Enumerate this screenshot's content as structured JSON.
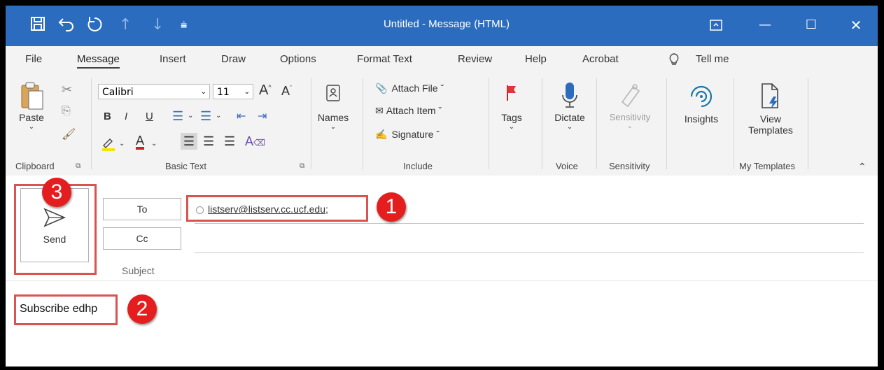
{
  "window": {
    "title": "Untitled  -  Message (HTML)"
  },
  "quick_access": [
    "save-icon",
    "undo-icon",
    "redo-icon",
    "up-arrow-icon",
    "down-arrow-icon",
    "customize-icon"
  ],
  "menu_tabs": [
    "File",
    "Message",
    "Insert",
    "Draw",
    "Options",
    "Format Text",
    "Review",
    "Help",
    "Acrobat"
  ],
  "active_tab": "Message",
  "tell_me": "Tell me",
  "ribbon": {
    "paste": "Paste",
    "font_name": "Calibri",
    "font_size": "11",
    "names": "Names",
    "attach_file": "Attach File ˇ",
    "attach_item": "Attach Item ˇ",
    "signature": "Signature ˇ",
    "tags": "Tags",
    "dictate": "Dictate",
    "sensitivity": "Sensitivity",
    "insights": "Insights",
    "view_templates_1": "View",
    "view_templates_2": "Templates",
    "groups": {
      "clipboard": "Clipboard",
      "basic_text": "Basic Text",
      "include": "Include",
      "voice": "Voice",
      "sensitivity": "Sensitivity",
      "my_templates": "My Templates"
    }
  },
  "compose": {
    "send": "Send",
    "to_label": "To",
    "cc_label": "Cc",
    "subject_label": "Subject",
    "to_value": "listserv@listserv.cc.ucf.edu;",
    "body": "Subscribe edhp"
  },
  "callouts": [
    "1",
    "2",
    "3"
  ],
  "colors": {
    "titlebar": "#2b6cbf",
    "highlight": "#d9534f",
    "badge": "#e41e1e"
  }
}
